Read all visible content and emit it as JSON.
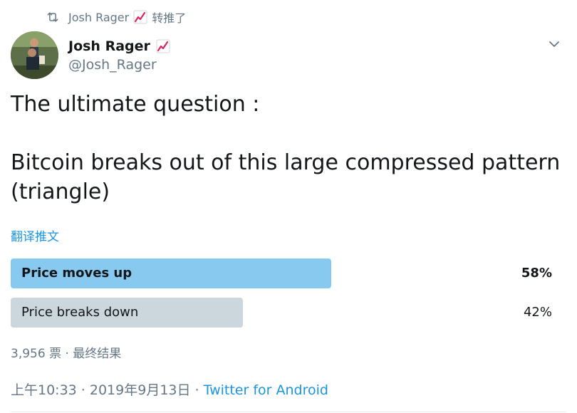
{
  "retweet": {
    "icon": "retweet-icon",
    "user": "Josh Rager",
    "emoji": "chart-increasing-emoji",
    "action": "转推了"
  },
  "author": {
    "display_name": "Josh Rager",
    "emoji": "chart-increasing-emoji",
    "handle": "@Josh_Rager"
  },
  "tweet": {
    "text": "The ultimate question :\n\nBitcoin breaks out of this large compressed pattern (triangle)"
  },
  "translate_label": "翻译推文",
  "poll": {
    "options": [
      {
        "label": "Price moves up",
        "percent_text": "58%",
        "percent": 58,
        "leading": true
      },
      {
        "label": "Price breaks down",
        "percent_text": "42%",
        "percent": 42,
        "leading": false
      }
    ],
    "meta": "3,956 票 · 最终结果"
  },
  "timestamp": {
    "time_date": "上午10:33 · 2019年9月13日 · ",
    "source": "Twitter for Android"
  },
  "colors": {
    "accent": "#1b95e0",
    "leading_bar": "#88c9ef",
    "other_bar": "#ccd6dd",
    "secondary_text": "#657786"
  }
}
